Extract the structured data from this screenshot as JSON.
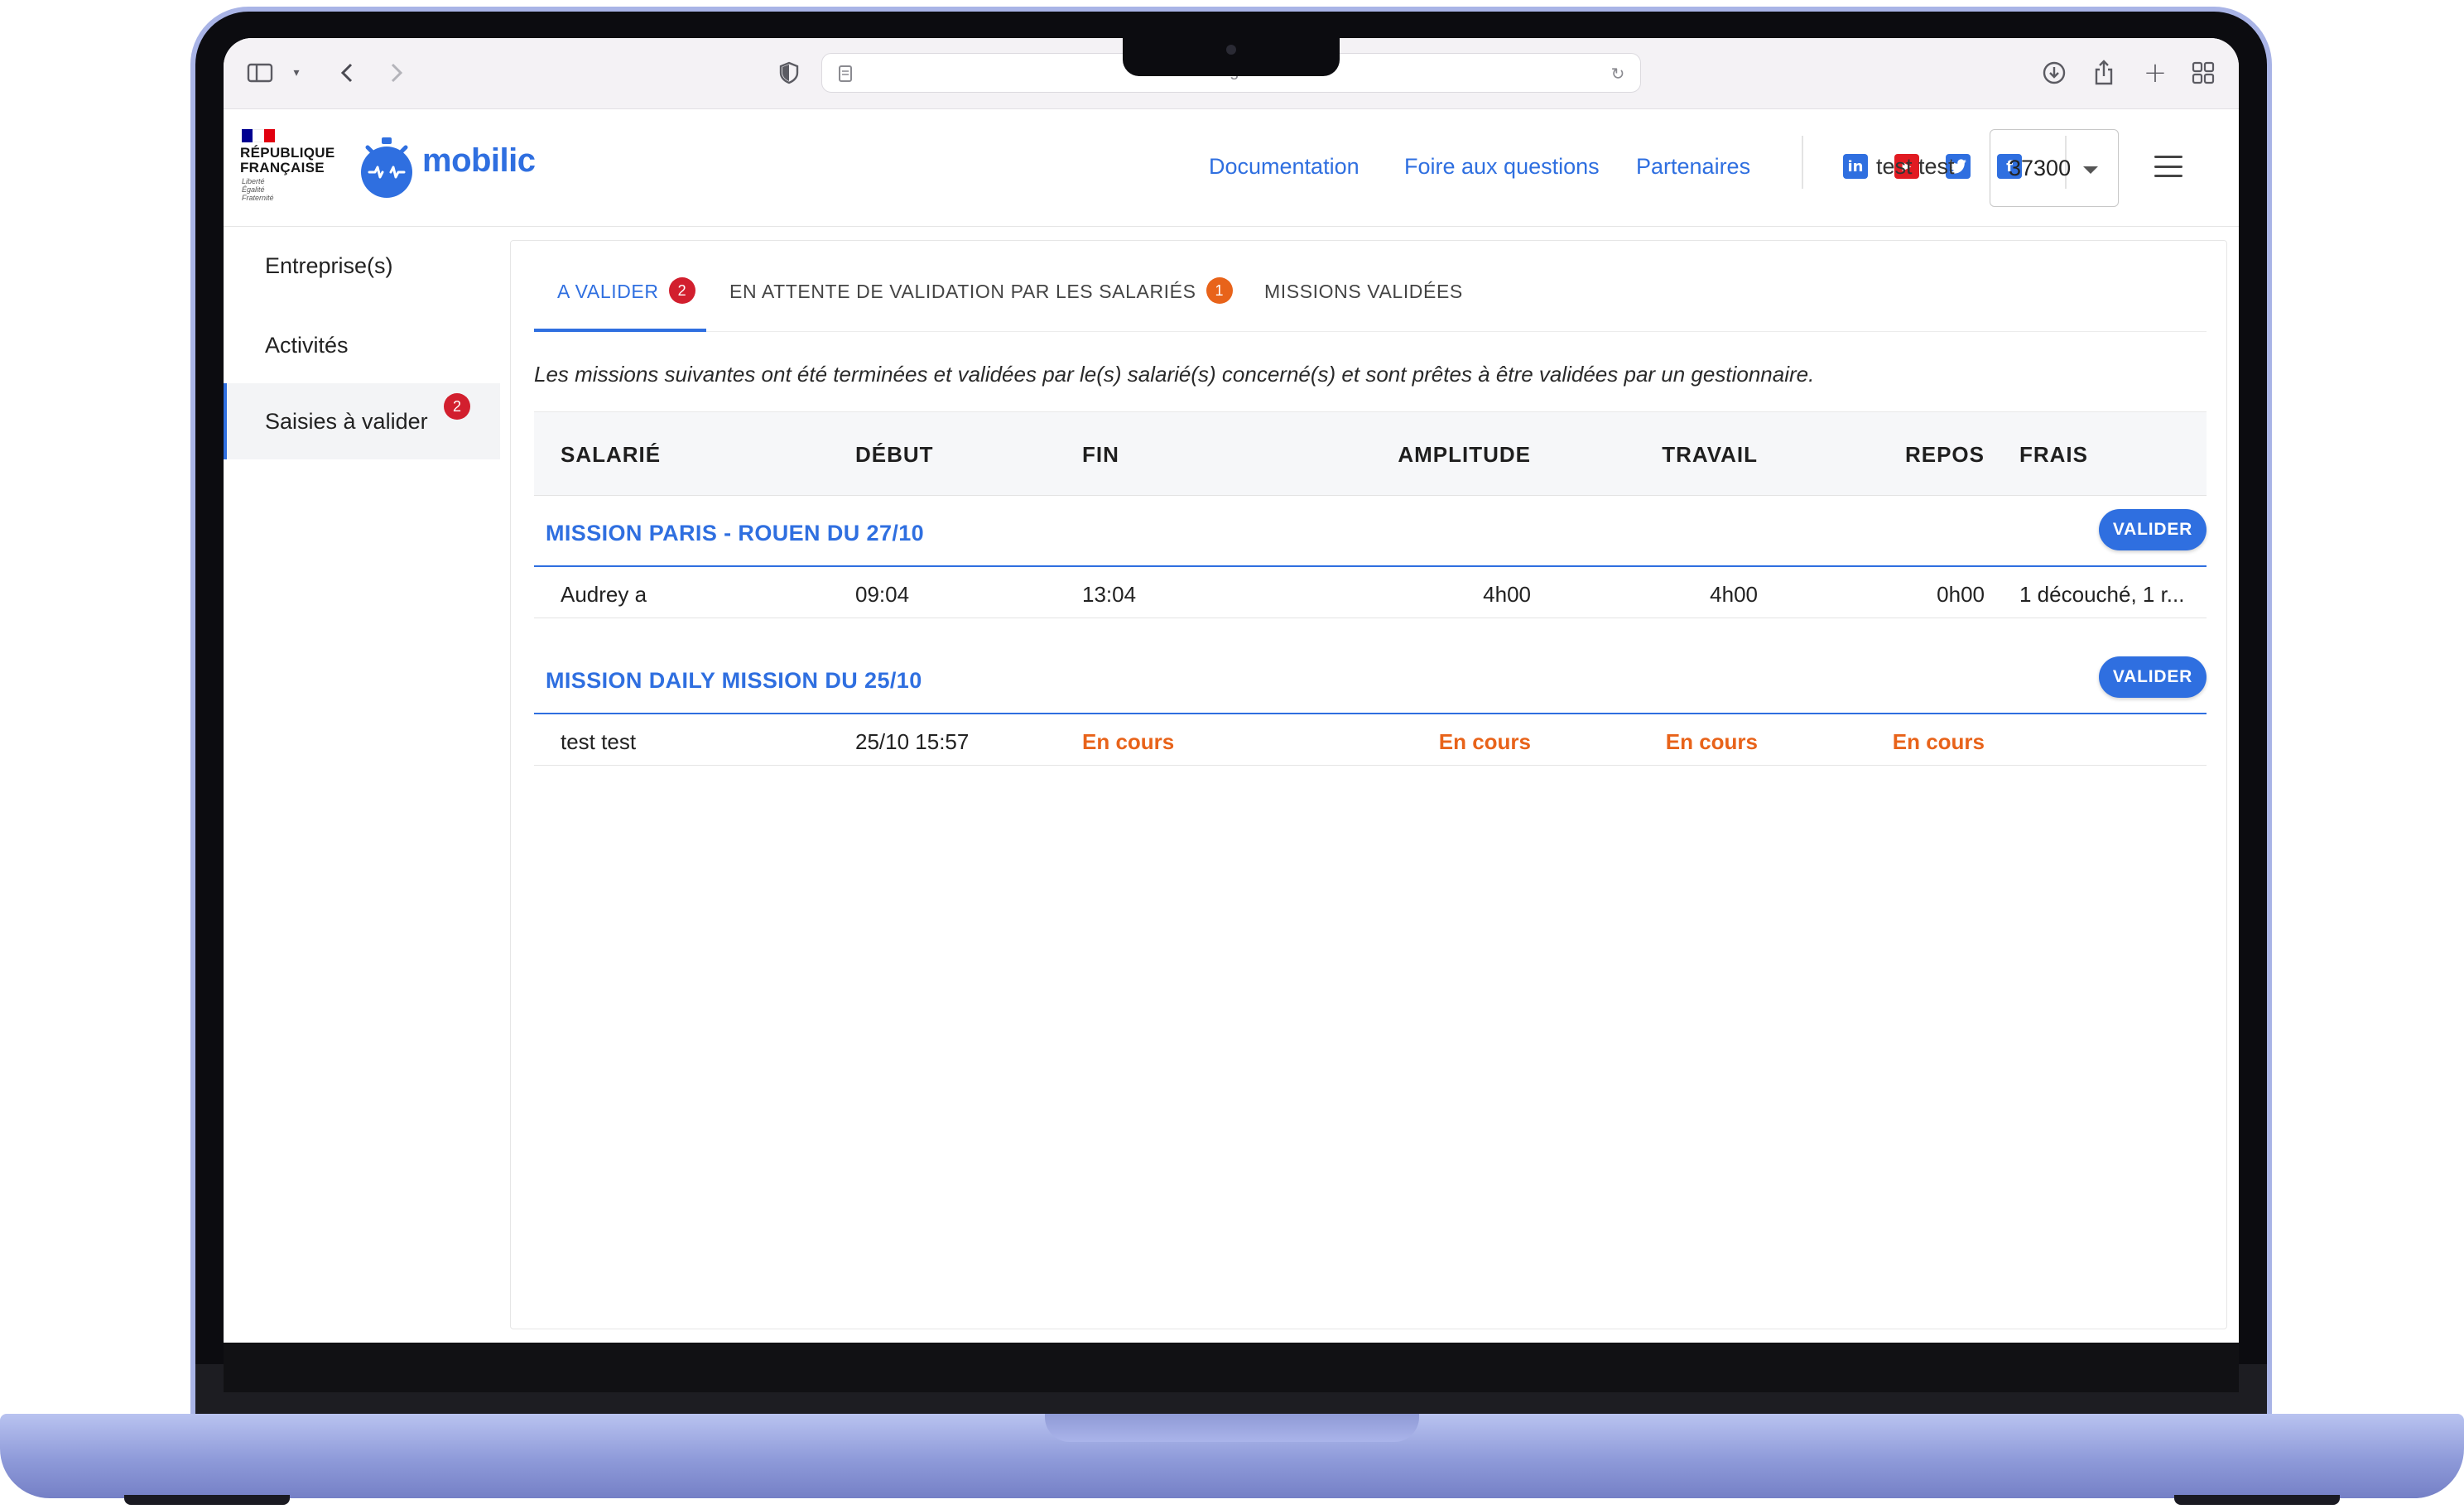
{
  "browser": {
    "url": "mobilic.beta.gouv.fr"
  },
  "header": {
    "rf_line1": "RÉPUBLIQUE",
    "rf_line2": "FRANÇAISE",
    "rf_motto1": "Liberté",
    "rf_motto2": "Égalité",
    "rf_motto3": "Fraternité",
    "app_name": "mobilic",
    "nav": [
      "Documentation",
      "Foire aux questions",
      "Partenaires"
    ],
    "socials": [
      "linkedin-icon",
      "youtube-icon",
      "twitter-icon",
      "facebook-icon"
    ],
    "user_name": "test test",
    "company": "37300"
  },
  "sidebar": {
    "items": [
      {
        "label": "Entreprise(s)"
      },
      {
        "label": "Activités"
      },
      {
        "label": "Saisies à valider",
        "badge": "2"
      }
    ]
  },
  "tabs": [
    {
      "label": "A VALIDER",
      "badge": "2"
    },
    {
      "label": "EN ATTENTE DE VALIDATION PAR LES SALARIÉS",
      "badge": "1"
    },
    {
      "label": "MISSIONS VALIDÉES"
    }
  ],
  "intro": "Les missions suivantes ont été terminées et validées par le(s) salarié(s) concerné(s) et sont prêtes à être validées par un gestionnaire.",
  "table": {
    "columns": [
      "SALARIÉ",
      "DÉBUT",
      "FIN",
      "AMPLITUDE",
      "TRAVAIL",
      "REPOS",
      "FRAIS"
    ],
    "valider_label": "VALIDER",
    "groups": [
      {
        "title": "MISSION PARIS - ROUEN DU 27/10",
        "row": {
          "salarie": "Audrey a",
          "debut": "09:04",
          "fin": "13:04",
          "amplitude": "4h00",
          "travail": "4h00",
          "repos": "0h00",
          "frais": "1 découché, 1 r..."
        }
      },
      {
        "title": "MISSION DAILY MISSION DU 25/10",
        "row": {
          "salarie": "test test",
          "debut": "25/10 15:57",
          "fin": "En cours",
          "amplitude": "En cours",
          "travail": "En cours",
          "repos": "En cours",
          "frais": ""
        }
      }
    ]
  },
  "colors": {
    "accent": "#2f6fe0",
    "badge_red": "#d21f2e",
    "badge_orange": "#e8631a",
    "frame": "#a9b4e6"
  }
}
